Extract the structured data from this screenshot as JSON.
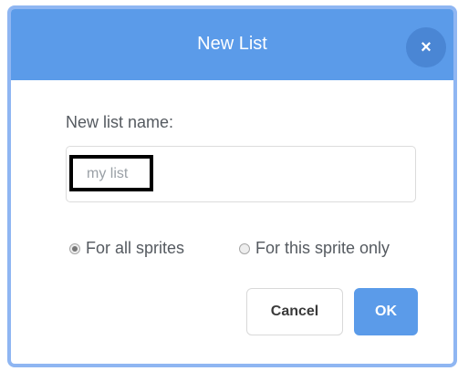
{
  "dialog": {
    "title": "New List",
    "close_icon": "close-icon",
    "close_glyph": "×",
    "name_label": "New list name:",
    "name_field": {
      "placeholder": "my list",
      "value": ""
    },
    "scope_options": [
      {
        "label": "For all sprites",
        "checked": true
      },
      {
        "label": "For this sprite only",
        "checked": false
      }
    ],
    "cancel_label": "Cancel",
    "ok_label": "OK"
  },
  "colors": {
    "header": "#5b9be9",
    "border": "#8fb6f2",
    "close_button": "#4a86d4",
    "ok_button": "#5b9be9"
  }
}
